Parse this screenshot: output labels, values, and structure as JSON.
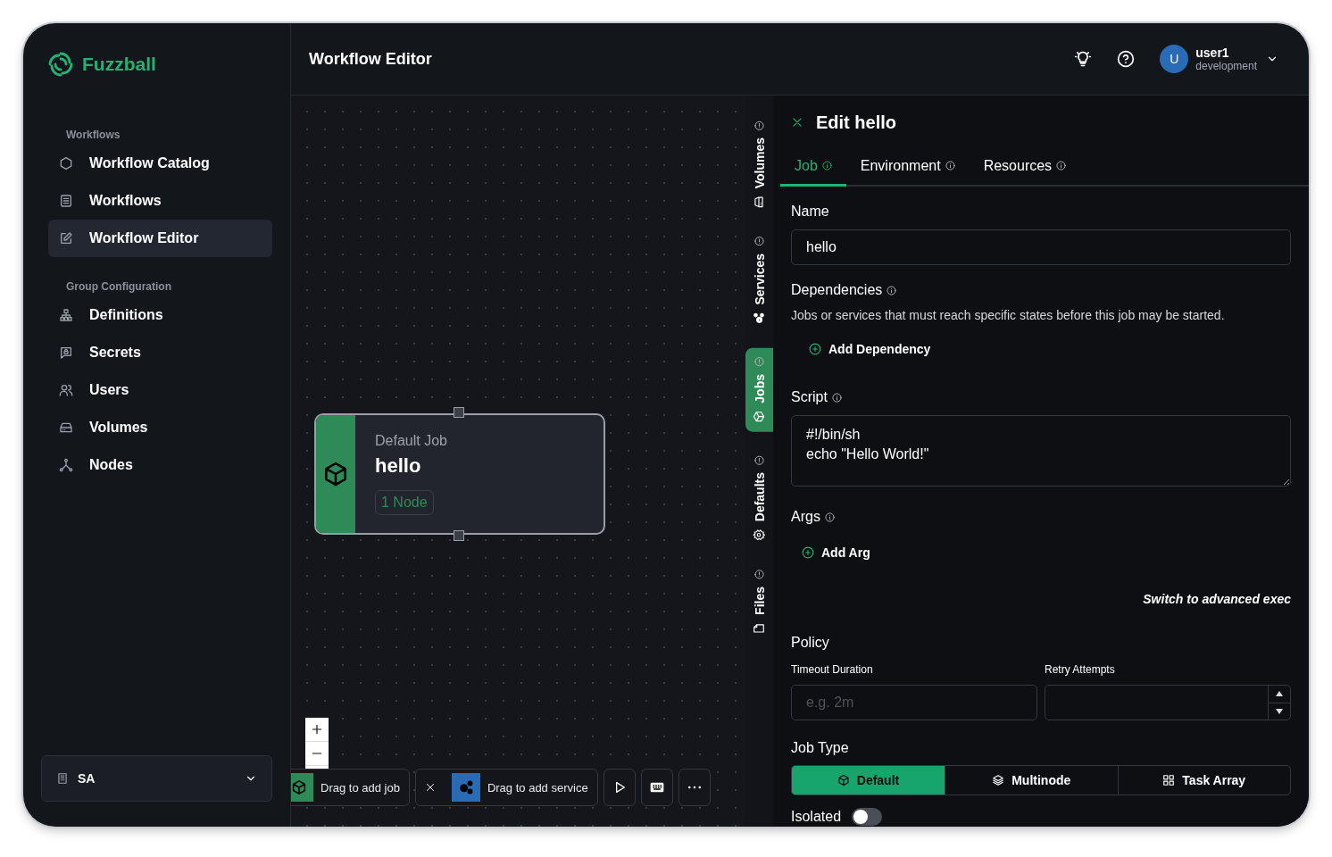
{
  "brand": {
    "name": "Fuzzball"
  },
  "sidebar": {
    "sections": [
      {
        "heading": "Workflows",
        "items": [
          {
            "label": "Workflow Catalog",
            "selected": false
          },
          {
            "label": "Workflows",
            "selected": false
          },
          {
            "label": "Workflow Editor",
            "selected": true
          }
        ]
      },
      {
        "heading": "Group Configuration",
        "items": [
          {
            "label": "Definitions",
            "selected": false
          },
          {
            "label": "Secrets",
            "selected": false
          },
          {
            "label": "Users",
            "selected": false
          },
          {
            "label": "Volumes",
            "selected": false
          },
          {
            "label": "Nodes",
            "selected": false
          }
        ]
      }
    ],
    "account": {
      "label": "SA"
    }
  },
  "header": {
    "title": "Workflow Editor",
    "user": {
      "initial": "U",
      "name": "user1",
      "environment": "development"
    }
  },
  "canvas": {
    "node": {
      "type_label": "Default Job",
      "name": "hello",
      "badge": "1 Node"
    },
    "toolbar": {
      "job_palette": "Drag to add job",
      "service_palette": "Drag to add service"
    }
  },
  "side_tabs": [
    {
      "label": "Volumes",
      "selected": false
    },
    {
      "label": "Services",
      "selected": false
    },
    {
      "label": "Jobs",
      "selected": true
    },
    {
      "label": "Defaults",
      "selected": false
    },
    {
      "label": "Files",
      "selected": false
    }
  ],
  "panel": {
    "title": "Edit hello",
    "tabs": [
      {
        "label": "Job",
        "selected": true
      },
      {
        "label": "Environment",
        "selected": false
      },
      {
        "label": "Resources",
        "selected": false
      }
    ],
    "name": {
      "label": "Name",
      "value": "hello"
    },
    "dependencies": {
      "label": "Dependencies",
      "description": "Jobs or services that must reach specific states before this job may be started.",
      "add_button": "Add Dependency"
    },
    "script": {
      "label": "Script",
      "value": "#!/bin/sh\necho \"Hello World!\""
    },
    "args": {
      "label": "Args",
      "add_button": "Add Arg"
    },
    "advanced_link": "Switch to advanced exec",
    "policy": {
      "heading": "Policy",
      "timeout": {
        "label": "Timeout Duration",
        "placeholder": "e.g. 2m"
      },
      "retries": {
        "label": "Retry Attempts"
      }
    },
    "job_type": {
      "label": "Job Type",
      "options": [
        {
          "label": "Default",
          "selected": true
        },
        {
          "label": "Multinode",
          "selected": false
        },
        {
          "label": "Task Array",
          "selected": false
        }
      ]
    },
    "isolated": {
      "label": "Isolated",
      "on": false
    }
  }
}
